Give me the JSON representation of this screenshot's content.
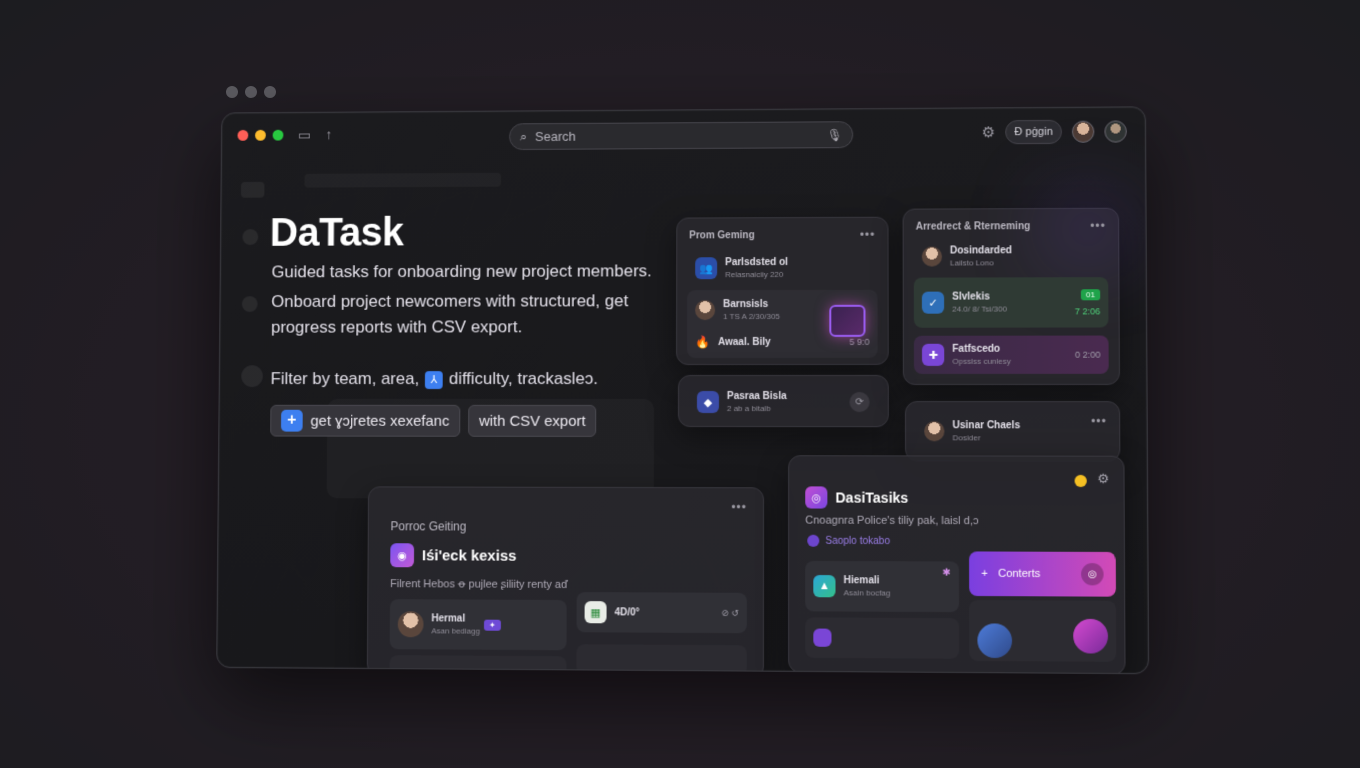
{
  "titlebar": {
    "search_placeholder": "Search",
    "login_label": "Ð pġgin"
  },
  "hero": {
    "title": "DaTask",
    "line1": "Guided tasks for onboarding new project members.",
    "line2": "Onboard project newcomers with structured, get",
    "line3": "progress reports with CSV export.",
    "filter_prefix": "Filter by team, area,",
    "filter_suffix": "difficulty, trackasleɔ.",
    "chip1": "get ɣɔjretes xexefanc",
    "chip2": "with CSV export"
  },
  "card_pro": {
    "head": "Prom Geming",
    "row1_title": "Parlsdsted ol",
    "row1_sub": "Relasnaiciiy 220",
    "row2_title": "Barnsisls",
    "row2_sub": "1 TS A 2/30/305",
    "row3_title": "Awaal. Bily",
    "row3_val": "5 9:0",
    "row4_title": "Pasraa Bisla",
    "row4_sub": "2 ab a bitalb"
  },
  "card_arr": {
    "head": "Arredrect & Rterneming",
    "row1_title": "Dosindarded",
    "row1_sub": "Lailsto Lono",
    "row2_title": "Slvlekis",
    "row2_sub": "24.0/ 8/ Tsi/300",
    "row2_tag": "01",
    "row2_val": "7 2:06",
    "row3_title": "Fatfscedo",
    "row3_sub": "Opsslss cunlesy",
    "row3_val": "0 2:00"
  },
  "card_usr": {
    "head": "Usinar Chaels",
    "sub": "Dosider"
  },
  "card_onb": {
    "head": "Porroc Geiting",
    "title": "Iśi'eck kexiss",
    "sub": "Filrent Hebos ꝋ pujlee ʂiliity renty aď",
    "row1_title": "Hermal",
    "row1_sub": "Asan bediagg",
    "row2_title": "4D/0°"
  },
  "card_ds": {
    "title": "DasiTasiks",
    "sub": "Cnoagnra Police's tiliy pak, laisl d,ɔ",
    "link": "Saoplo tokabo",
    "row1_title": "Hiemali",
    "row1_sub": "Asain bocfag",
    "btn_label": "Conterts"
  }
}
